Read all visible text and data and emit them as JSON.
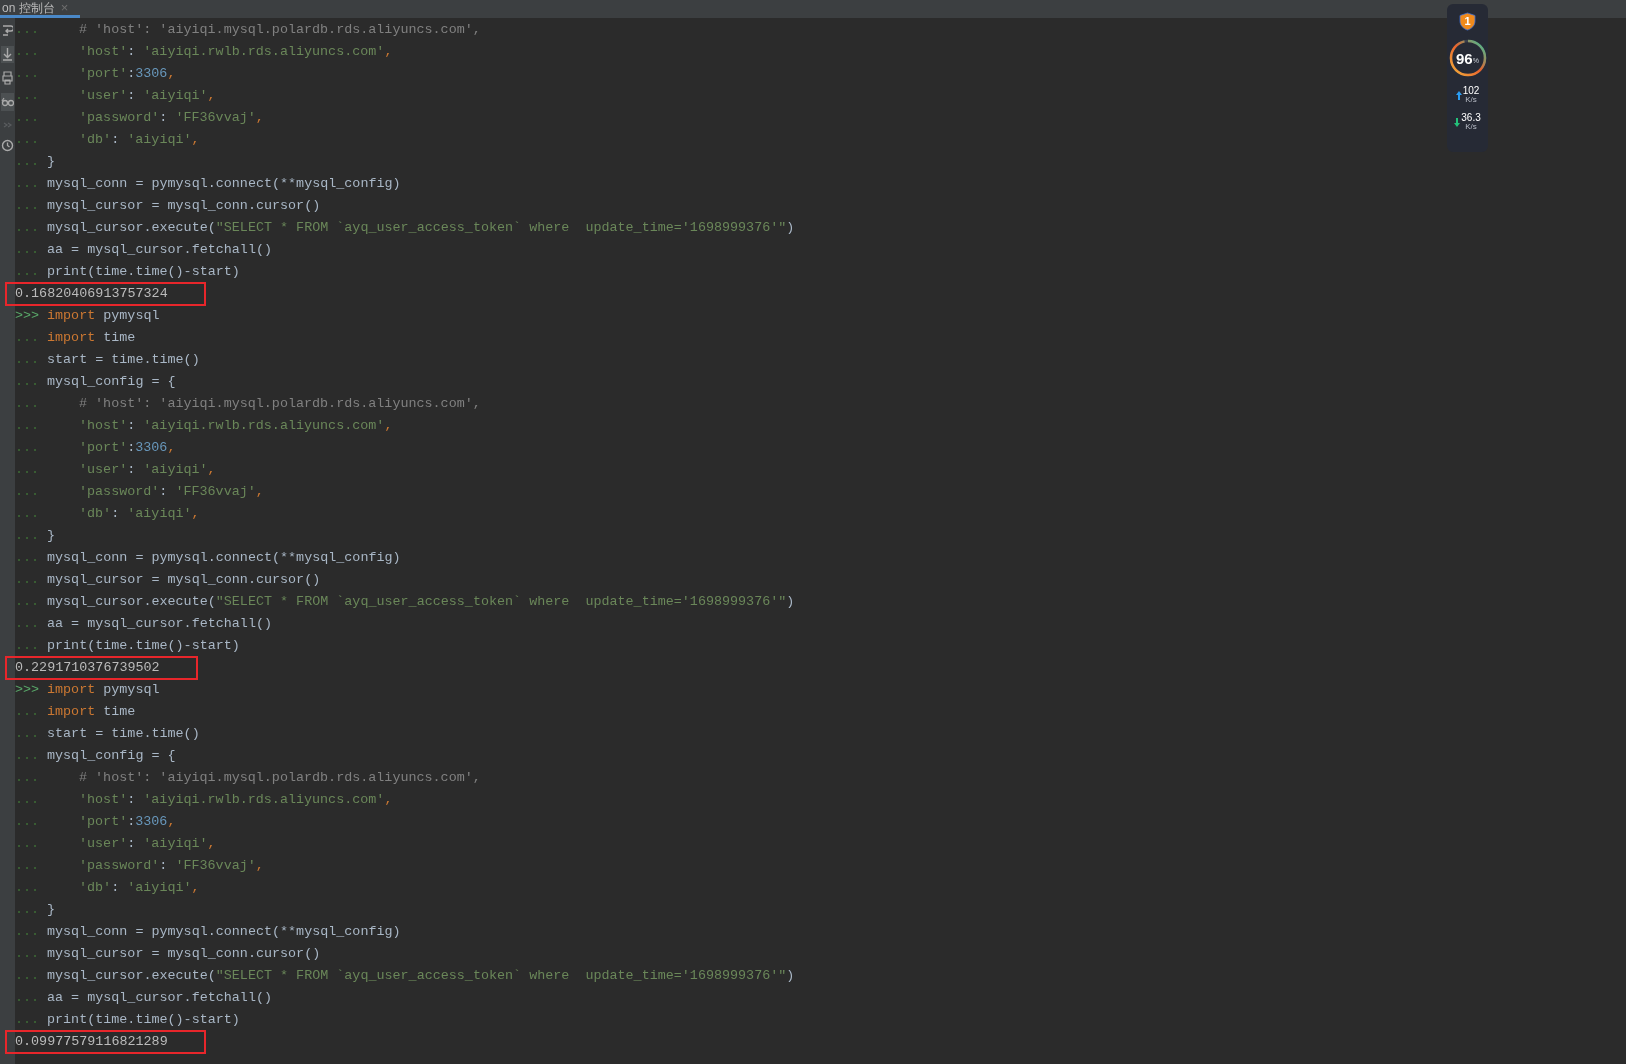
{
  "tab": {
    "label": "on 控制台",
    "selected": true,
    "close": "×"
  },
  "monitor": {
    "badge": "1",
    "percent": "96",
    "percent_unit": "%",
    "level": 0.96,
    "upload": "102",
    "upload_unit": "K/s",
    "download": "36.3",
    "download_unit": "K/s"
  },
  "lines": [
    {
      "prompt": "...",
      "indent": true,
      "tokens": [
        {
          "kind": "comment",
          "t": "# 'host': 'aiyiqi.mysql.polardb.rds.aliyuncs.com',"
        }
      ]
    },
    {
      "prompt": "...",
      "indent": true,
      "tokens": [
        {
          "kind": "string",
          "t": "'host'"
        },
        {
          "kind": "code",
          "t": ": "
        },
        {
          "kind": "string",
          "t": "'aiyiqi.rwlb.rds.aliyuncs.com'"
        },
        {
          "kind": "keyword",
          "t": ","
        }
      ]
    },
    {
      "prompt": "...",
      "indent": true,
      "tokens": [
        {
          "kind": "string",
          "t": "'port'"
        },
        {
          "kind": "code",
          "t": ":"
        },
        {
          "kind": "number",
          "t": "3306"
        },
        {
          "kind": "keyword",
          "t": ","
        }
      ]
    },
    {
      "prompt": "...",
      "indent": true,
      "tokens": [
        {
          "kind": "string",
          "t": "'user'"
        },
        {
          "kind": "code",
          "t": ": "
        },
        {
          "kind": "string",
          "t": "'aiyiqi'"
        },
        {
          "kind": "keyword",
          "t": ","
        }
      ]
    },
    {
      "prompt": "...",
      "indent": true,
      "tokens": [
        {
          "kind": "string",
          "t": "'password'"
        },
        {
          "kind": "code",
          "t": ": "
        },
        {
          "kind": "string",
          "t": "'FF36vvaj'"
        },
        {
          "kind": "keyword",
          "t": ","
        }
      ]
    },
    {
      "prompt": "...",
      "indent": true,
      "tokens": [
        {
          "kind": "string",
          "t": "'db'"
        },
        {
          "kind": "code",
          "t": ": "
        },
        {
          "kind": "string",
          "t": "'aiyiqi'"
        },
        {
          "kind": "keyword",
          "t": ","
        }
      ]
    },
    {
      "prompt": "...",
      "indent": false,
      "tokens": [
        {
          "kind": "code",
          "t": "}"
        }
      ]
    },
    {
      "prompt": "...",
      "indent": false,
      "tokens": [
        {
          "kind": "code",
          "t": "mysql_conn = pymysql.connect(**mysql_config)"
        }
      ]
    },
    {
      "prompt": "...",
      "indent": false,
      "tokens": [
        {
          "kind": "code",
          "t": "mysql_cursor = mysql_conn.cursor()"
        }
      ]
    },
    {
      "prompt": "...",
      "indent": false,
      "tokens": [
        {
          "kind": "code",
          "t": "mysql_cursor.execute("
        },
        {
          "kind": "string",
          "t": "\"SELECT * FROM `ayq_user_access_token` where  update_time='1698999376'\""
        },
        {
          "kind": "code",
          "t": ")"
        }
      ]
    },
    {
      "prompt": "...",
      "indent": false,
      "tokens": [
        {
          "kind": "code",
          "t": "aa = mysql_cursor.fetchall()"
        }
      ]
    },
    {
      "prompt": "...",
      "indent": false,
      "tokens": [
        {
          "kind": "code",
          "t": "print(time.time()-start)"
        }
      ]
    },
    {
      "boxed": true,
      "output": "0.16820406913757324"
    },
    {
      "prompt": ">>>",
      "indent": false,
      "tokens": [
        {
          "kind": "keyword",
          "t": "import "
        },
        {
          "kind": "code",
          "t": "pymysql"
        }
      ]
    },
    {
      "prompt": "...",
      "indent": false,
      "tokens": [
        {
          "kind": "keyword",
          "t": "import "
        },
        {
          "kind": "code",
          "t": "time"
        }
      ]
    },
    {
      "prompt": "...",
      "indent": false,
      "tokens": [
        {
          "kind": "code",
          "t": "start = time.time()"
        }
      ]
    },
    {
      "prompt": "...",
      "indent": false,
      "tokens": [
        {
          "kind": "code",
          "t": "mysql_config = {"
        }
      ]
    },
    {
      "prompt": "...",
      "indent": true,
      "tokens": [
        {
          "kind": "comment",
          "t": "# 'host': 'aiyiqi.mysql.polardb.rds.aliyuncs.com',"
        }
      ]
    },
    {
      "prompt": "...",
      "indent": true,
      "tokens": [
        {
          "kind": "string",
          "t": "'host'"
        },
        {
          "kind": "code",
          "t": ": "
        },
        {
          "kind": "string",
          "t": "'aiyiqi.rwlb.rds.aliyuncs.com'"
        },
        {
          "kind": "keyword",
          "t": ","
        }
      ]
    },
    {
      "prompt": "...",
      "indent": true,
      "tokens": [
        {
          "kind": "string",
          "t": "'port'"
        },
        {
          "kind": "code",
          "t": ":"
        },
        {
          "kind": "number",
          "t": "3306"
        },
        {
          "kind": "keyword",
          "t": ","
        }
      ]
    },
    {
      "prompt": "...",
      "indent": true,
      "tokens": [
        {
          "kind": "string",
          "t": "'user'"
        },
        {
          "kind": "code",
          "t": ": "
        },
        {
          "kind": "string",
          "t": "'aiyiqi'"
        },
        {
          "kind": "keyword",
          "t": ","
        }
      ]
    },
    {
      "prompt": "...",
      "indent": true,
      "tokens": [
        {
          "kind": "string",
          "t": "'password'"
        },
        {
          "kind": "code",
          "t": ": "
        },
        {
          "kind": "string",
          "t": "'FF36vvaj'"
        },
        {
          "kind": "keyword",
          "t": ","
        }
      ]
    },
    {
      "prompt": "...",
      "indent": true,
      "tokens": [
        {
          "kind": "string",
          "t": "'db'"
        },
        {
          "kind": "code",
          "t": ": "
        },
        {
          "kind": "string",
          "t": "'aiyiqi'"
        },
        {
          "kind": "keyword",
          "t": ","
        }
      ]
    },
    {
      "prompt": "...",
      "indent": false,
      "tokens": [
        {
          "kind": "code",
          "t": "}"
        }
      ]
    },
    {
      "prompt": "...",
      "indent": false,
      "tokens": [
        {
          "kind": "code",
          "t": "mysql_conn = pymysql.connect(**mysql_config)"
        }
      ]
    },
    {
      "prompt": "...",
      "indent": false,
      "tokens": [
        {
          "kind": "code",
          "t": "mysql_cursor = mysql_conn.cursor()"
        }
      ]
    },
    {
      "prompt": "...",
      "indent": false,
      "tokens": [
        {
          "kind": "code",
          "t": "mysql_cursor.execute("
        },
        {
          "kind": "string",
          "t": "\"SELECT * FROM `ayq_user_access_token` where  update_time='1698999376'\""
        },
        {
          "kind": "code",
          "t": ")"
        }
      ]
    },
    {
      "prompt": "...",
      "indent": false,
      "tokens": [
        {
          "kind": "code",
          "t": "aa = mysql_cursor.fetchall()"
        }
      ]
    },
    {
      "prompt": "...",
      "indent": false,
      "tokens": [
        {
          "kind": "code",
          "t": "print(time.time()-start)"
        }
      ]
    },
    {
      "boxed": true,
      "output": "0.2291710376739502"
    },
    {
      "prompt": ">>>",
      "indent": false,
      "tokens": [
        {
          "kind": "keyword",
          "t": "import "
        },
        {
          "kind": "code",
          "t": "pymysql"
        }
      ]
    },
    {
      "prompt": "...",
      "indent": false,
      "tokens": [
        {
          "kind": "keyword",
          "t": "import "
        },
        {
          "kind": "code",
          "t": "time"
        }
      ]
    },
    {
      "prompt": "...",
      "indent": false,
      "tokens": [
        {
          "kind": "code",
          "t": "start = time.time()"
        }
      ]
    },
    {
      "prompt": "...",
      "indent": false,
      "tokens": [
        {
          "kind": "code",
          "t": "mysql_config = {"
        }
      ]
    },
    {
      "prompt": "...",
      "indent": true,
      "tokens": [
        {
          "kind": "comment",
          "t": "# 'host': 'aiyiqi.mysql.polardb.rds.aliyuncs.com',"
        }
      ]
    },
    {
      "prompt": "...",
      "indent": true,
      "tokens": [
        {
          "kind": "string",
          "t": "'host'"
        },
        {
          "kind": "code",
          "t": ": "
        },
        {
          "kind": "string",
          "t": "'aiyiqi.rwlb.rds.aliyuncs.com'"
        },
        {
          "kind": "keyword",
          "t": ","
        }
      ]
    },
    {
      "prompt": "...",
      "indent": true,
      "tokens": [
        {
          "kind": "string",
          "t": "'port'"
        },
        {
          "kind": "code",
          "t": ":"
        },
        {
          "kind": "number",
          "t": "3306"
        },
        {
          "kind": "keyword",
          "t": ","
        }
      ]
    },
    {
      "prompt": "...",
      "indent": true,
      "tokens": [
        {
          "kind": "string",
          "t": "'user'"
        },
        {
          "kind": "code",
          "t": ": "
        },
        {
          "kind": "string",
          "t": "'aiyiqi'"
        },
        {
          "kind": "keyword",
          "t": ","
        }
      ]
    },
    {
      "prompt": "...",
      "indent": true,
      "tokens": [
        {
          "kind": "string",
          "t": "'password'"
        },
        {
          "kind": "code",
          "t": ": "
        },
        {
          "kind": "string",
          "t": "'FF36vvaj'"
        },
        {
          "kind": "keyword",
          "t": ","
        }
      ]
    },
    {
      "prompt": "...",
      "indent": true,
      "tokens": [
        {
          "kind": "string",
          "t": "'db'"
        },
        {
          "kind": "code",
          "t": ": "
        },
        {
          "kind": "string",
          "t": "'aiyiqi'"
        },
        {
          "kind": "keyword",
          "t": ","
        }
      ]
    },
    {
      "prompt": "...",
      "indent": false,
      "tokens": [
        {
          "kind": "code",
          "t": "}"
        }
      ]
    },
    {
      "prompt": "...",
      "indent": false,
      "tokens": [
        {
          "kind": "code",
          "t": "mysql_conn = pymysql.connect(**mysql_config)"
        }
      ]
    },
    {
      "prompt": "...",
      "indent": false,
      "tokens": [
        {
          "kind": "code",
          "t": "mysql_cursor = mysql_conn.cursor()"
        }
      ]
    },
    {
      "prompt": "...",
      "indent": false,
      "tokens": [
        {
          "kind": "code",
          "t": "mysql_cursor.execute("
        },
        {
          "kind": "string",
          "t": "\"SELECT * FROM `ayq_user_access_token` where  update_time='1698999376'\""
        },
        {
          "kind": "code",
          "t": ")"
        }
      ]
    },
    {
      "prompt": "...",
      "indent": false,
      "tokens": [
        {
          "kind": "code",
          "t": "aa = mysql_cursor.fetchall()"
        }
      ]
    },
    {
      "prompt": "...",
      "indent": false,
      "tokens": [
        {
          "kind": "code",
          "t": "print(time.time()-start)"
        }
      ]
    },
    {
      "boxed": true,
      "output": "0.09977579116821289"
    }
  ]
}
